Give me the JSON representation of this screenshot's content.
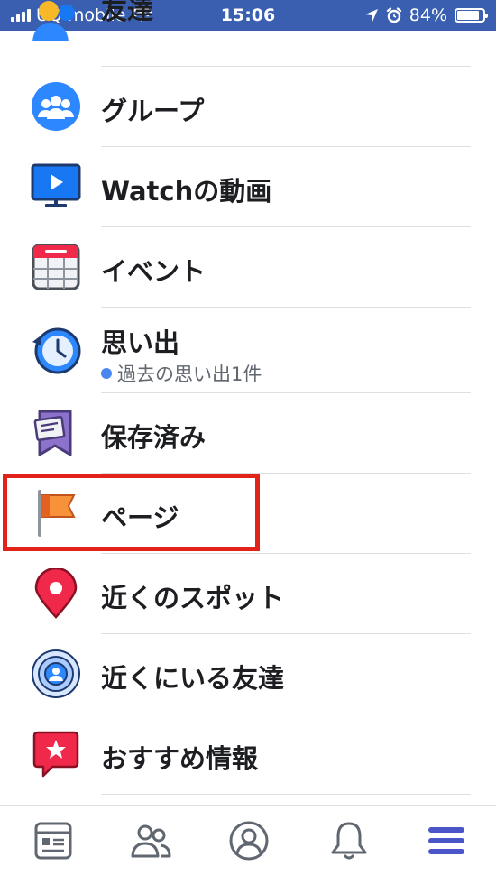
{
  "status_bar": {
    "carrier": "UQ mobile",
    "time": "15:06",
    "battery": "84%",
    "battery_level": 0.84
  },
  "menu": {
    "items": [
      {
        "label": "友達",
        "icon": "friends-icon"
      },
      {
        "label": "グループ",
        "icon": "groups-icon"
      },
      {
        "label": "Watchの動画",
        "icon": "watch-video-icon"
      },
      {
        "label": "イベント",
        "icon": "events-calendar-icon"
      },
      {
        "label": "思い出",
        "sublabel": "過去の思い出1件",
        "icon": "memories-clock-icon"
      },
      {
        "label": "保存済み",
        "icon": "saved-bookmark-icon"
      },
      {
        "label": "ページ",
        "icon": "pages-flag-icon",
        "highlighted": true
      },
      {
        "label": "近くのスポット",
        "icon": "nearby-places-pin-icon"
      },
      {
        "label": "近くにいる友達",
        "icon": "nearby-friends-icon"
      },
      {
        "label": "おすすめ情報",
        "icon": "recommendations-star-icon"
      }
    ]
  },
  "tab_bar": {
    "tabs": [
      {
        "icon": "news-feed-icon"
      },
      {
        "icon": "friends-requests-icon"
      },
      {
        "icon": "profile-icon"
      },
      {
        "icon": "notifications-bell-icon"
      },
      {
        "icon": "menu-hamburger-icon",
        "active": true
      }
    ]
  },
  "colors": {
    "status_bar": "#3b5fb0",
    "highlight_border": "#e2231a",
    "active_tab": "#4a55c8",
    "inactive_tab": "#606770"
  }
}
